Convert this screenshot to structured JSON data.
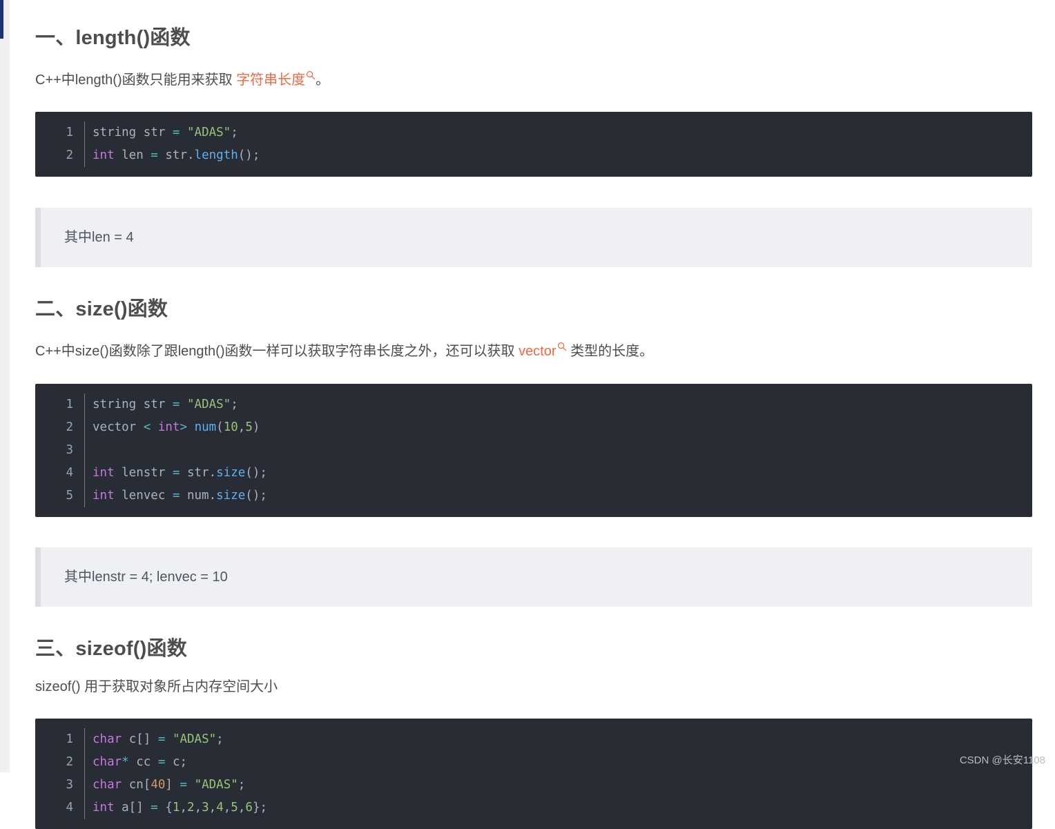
{
  "document": {
    "watermark": "CSDN @长安1108"
  },
  "scrollbar": {
    "name": "vertical-scrollbar"
  },
  "sections": [
    {
      "heading": "一、length()函数",
      "paragraph_prefix": "C++中length()函数只能用来获取 ",
      "paragraph_link": "字符串长度",
      "paragraph_suffix": "。",
      "quote": "其中len = 4",
      "code": {
        "lines": [
          {
            "n": "1",
            "tokens": [
              {
                "t": "string str ",
                "c": "t-plain"
              },
              {
                "t": "=",
                "c": "t-op"
              },
              {
                "t": " ",
                "c": "t-plain"
              },
              {
                "t": "\"ADAS\"",
                "c": "t-str"
              },
              {
                "t": ";",
                "c": "t-punc"
              }
            ]
          },
          {
            "n": "2",
            "tokens": [
              {
                "t": "int",
                "c": "t-kw"
              },
              {
                "t": " len ",
                "c": "t-plain"
              },
              {
                "t": "=",
                "c": "t-op"
              },
              {
                "t": " str.",
                "c": "t-plain"
              },
              {
                "t": "length",
                "c": "t-fn"
              },
              {
                "t": "();",
                "c": "t-punc"
              }
            ]
          }
        ]
      }
    },
    {
      "heading": "二、size()函数",
      "paragraph_prefix": "C++中size()函数除了跟length()函数一样可以获取字符串长度之外，还可以获取 ",
      "paragraph_link": "vector",
      "paragraph_suffix": " 类型的长度。",
      "quote": "其中lenstr = 4; lenvec = 10",
      "code": {
        "lines": [
          {
            "n": "1",
            "tokens": [
              {
                "t": "string str ",
                "c": "t-plain"
              },
              {
                "t": "=",
                "c": "t-op"
              },
              {
                "t": " ",
                "c": "t-plain"
              },
              {
                "t": "\"ADAS\"",
                "c": "t-str"
              },
              {
                "t": ";",
                "c": "t-punc"
              }
            ]
          },
          {
            "n": "2",
            "tokens": [
              {
                "t": "vector ",
                "c": "t-plain"
              },
              {
                "t": "<",
                "c": "t-ang"
              },
              {
                "t": " ",
                "c": "t-plain"
              },
              {
                "t": "int",
                "c": "t-kw"
              },
              {
                "t": ">",
                "c": "t-ang"
              },
              {
                "t": " ",
                "c": "t-plain"
              },
              {
                "t": "num",
                "c": "t-fn"
              },
              {
                "t": "(",
                "c": "t-punc"
              },
              {
                "t": "10",
                "c": "t-num2"
              },
              {
                "t": ",",
                "c": "t-punc"
              },
              {
                "t": "5",
                "c": "t-num2"
              },
              {
                "t": ")",
                "c": "t-punc"
              }
            ]
          },
          {
            "n": "3",
            "tokens": []
          },
          {
            "n": "4",
            "tokens": [
              {
                "t": "int",
                "c": "t-kw"
              },
              {
                "t": " lenstr ",
                "c": "t-plain"
              },
              {
                "t": "=",
                "c": "t-op"
              },
              {
                "t": " str.",
                "c": "t-plain"
              },
              {
                "t": "size",
                "c": "t-fn"
              },
              {
                "t": "();",
                "c": "t-punc"
              }
            ]
          },
          {
            "n": "5",
            "tokens": [
              {
                "t": "int",
                "c": "t-kw"
              },
              {
                "t": " lenvec ",
                "c": "t-plain"
              },
              {
                "t": "=",
                "c": "t-op"
              },
              {
                "t": " num.",
                "c": "t-plain"
              },
              {
                "t": "size",
                "c": "t-fn"
              },
              {
                "t": "();",
                "c": "t-punc"
              }
            ]
          }
        ]
      }
    },
    {
      "heading": "三、sizeof()函数",
      "paragraph_prefix": "sizeof() 用于获取对象所占内存空间大小",
      "paragraph_link": "",
      "paragraph_suffix": "",
      "quote": null,
      "code": {
        "lines": [
          {
            "n": "1",
            "tokens": [
              {
                "t": "char",
                "c": "t-kw"
              },
              {
                "t": " c[] ",
                "c": "t-plain"
              },
              {
                "t": "=",
                "c": "t-op"
              },
              {
                "t": " ",
                "c": "t-plain"
              },
              {
                "t": "\"ADAS\"",
                "c": "t-str"
              },
              {
                "t": ";",
                "c": "t-punc"
              }
            ]
          },
          {
            "n": "2",
            "tokens": [
              {
                "t": "char",
                "c": "t-kw"
              },
              {
                "t": "*",
                "c": "t-op"
              },
              {
                "t": " cc ",
                "c": "t-plain"
              },
              {
                "t": "=",
                "c": "t-op"
              },
              {
                "t": " c;",
                "c": "t-plain"
              }
            ]
          },
          {
            "n": "3",
            "tokens": [
              {
                "t": "char",
                "c": "t-kw"
              },
              {
                "t": " cn[",
                "c": "t-plain"
              },
              {
                "t": "40",
                "c": "t-num"
              },
              {
                "t": "] ",
                "c": "t-plain"
              },
              {
                "t": "=",
                "c": "t-op"
              },
              {
                "t": " ",
                "c": "t-plain"
              },
              {
                "t": "\"ADAS\"",
                "c": "t-str"
              },
              {
                "t": ";",
                "c": "t-punc"
              }
            ]
          },
          {
            "n": "4",
            "tokens": [
              {
                "t": "int",
                "c": "t-kw"
              },
              {
                "t": " a[] ",
                "c": "t-plain"
              },
              {
                "t": "=",
                "c": "t-op"
              },
              {
                "t": " {",
                "c": "t-punc"
              },
              {
                "t": "1",
                "c": "t-num2"
              },
              {
                "t": ",",
                "c": "t-punc"
              },
              {
                "t": "2",
                "c": "t-num2"
              },
              {
                "t": ",",
                "c": "t-punc"
              },
              {
                "t": "3",
                "c": "t-num2"
              },
              {
                "t": ",",
                "c": "t-punc"
              },
              {
                "t": "4",
                "c": "t-num2"
              },
              {
                "t": ",",
                "c": "t-punc"
              },
              {
                "t": "5",
                "c": "t-num2"
              },
              {
                "t": ",",
                "c": "t-punc"
              },
              {
                "t": "6",
                "c": "t-num2"
              },
              {
                "t": "};",
                "c": "t-punc"
              }
            ]
          }
        ]
      }
    }
  ],
  "colors": {
    "link": "#ec6941",
    "code_bg": "#282c34",
    "quote_bg": "#eef0f4",
    "quote_border": "#dcdee3",
    "heading": "#4d4d4d",
    "scrollbar_thumb": "#1d3471"
  }
}
